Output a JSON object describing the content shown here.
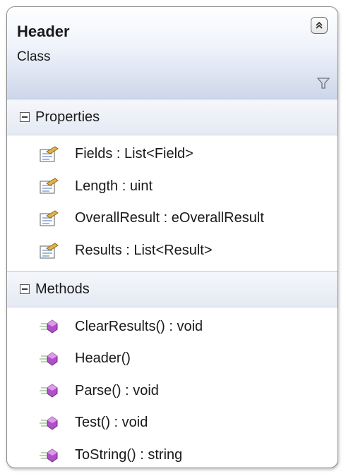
{
  "class_box": {
    "name": "Header",
    "stereotype": "Class",
    "collapse_icon": "double-chevron-up-icon",
    "filter_icon": "filter-icon"
  },
  "properties": {
    "title": "Properties",
    "icon": "property-icon",
    "items": [
      {
        "label": "Fields : List<Field>"
      },
      {
        "label": "Length : uint"
      },
      {
        "label": "OverallResult : eOverallResult"
      },
      {
        "label": "Results : List<Result>"
      }
    ]
  },
  "methods": {
    "title": "Methods",
    "icon": "method-icon",
    "items": [
      {
        "label": "ClearResults() : void"
      },
      {
        "label": "Header()"
      },
      {
        "label": "Parse() : void"
      },
      {
        "label": "Test() : void"
      },
      {
        "label": "ToString() : string"
      }
    ]
  },
  "colors": {
    "method_icon": "#b04fc8",
    "property_icon": "#e2b24a",
    "border": "#8a8a8a"
  }
}
